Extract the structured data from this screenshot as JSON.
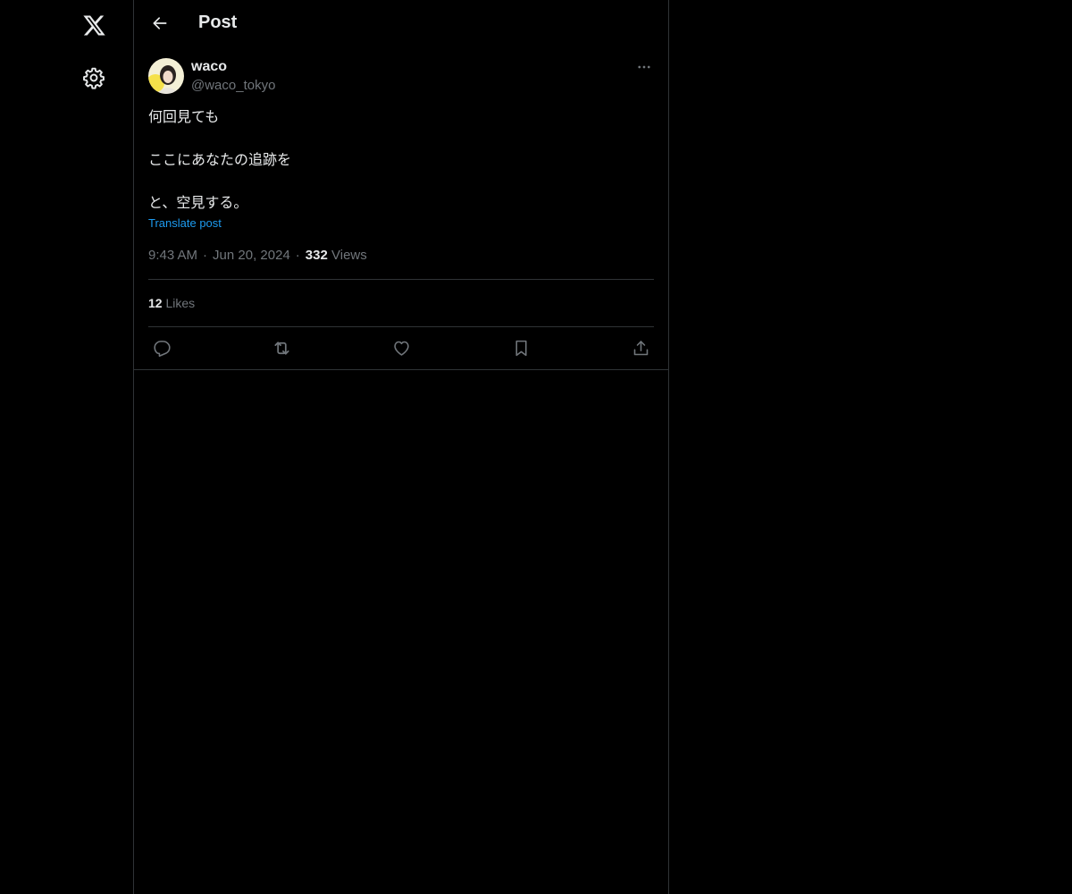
{
  "nav": {
    "logo_icon": "x-logo-icon",
    "settings_icon": "gear-icon"
  },
  "header": {
    "back_icon": "arrow-left-icon",
    "title": "Post"
  },
  "post": {
    "author": {
      "name": "waco",
      "handle": "@waco_tokyo"
    },
    "text_lines": [
      "何回見ても",
      "ここにあなたの追跡を",
      "と、空見する。"
    ],
    "translate_label": "Translate post",
    "time": "9:43 AM",
    "date": "Jun 20, 2024",
    "separator": "·",
    "views_count": "332",
    "views_label": "Views",
    "likes_count": "12",
    "likes_label": "Likes"
  },
  "actions": [
    "reply-icon",
    "repost-icon",
    "like-icon",
    "bookmark-icon",
    "share-icon"
  ],
  "colors": {
    "background": "#000000",
    "text": "#e7e9ea",
    "muted": "#71767b",
    "accent": "#1d9bf0",
    "border": "#2f3336"
  }
}
